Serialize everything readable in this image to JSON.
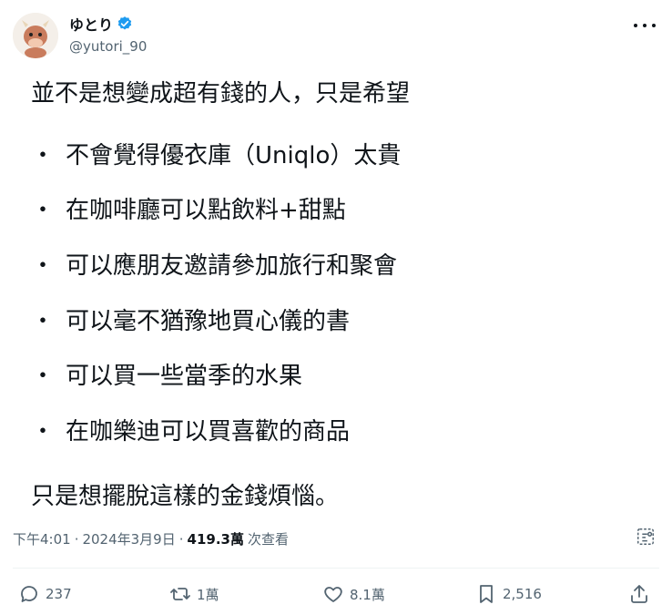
{
  "author": {
    "display_name": "ゆとり",
    "handle": "@yutori_90",
    "verified": true,
    "avatar_icon": "cartoon-cow-avatar"
  },
  "tweet": {
    "lines": [
      "並不是想變成超有錢的人，只是希望"
    ],
    "bullets": [
      "不會覺得優衣庫（Uniqlo）太貴",
      "在咖啡廳可以點飲料+甜點",
      "可以應朋友邀請參加旅行和聚會",
      "可以毫不猶豫地買心儀的書",
      "可以買一些當季的水果",
      "在咖樂迪可以買喜歡的商品"
    ],
    "bullet_symbol": "・",
    "closing": "只是想擺脫這樣的金錢煩惱。"
  },
  "meta": {
    "time": "下午4:01",
    "sep": "·",
    "date": "2024年3月9日",
    "sep2": "·",
    "views": "419.3萬",
    "views_label": "次查看"
  },
  "actions": {
    "reply_count": "237",
    "retweet_count": "1萬",
    "like_count": "8.1萬",
    "bookmark_count": "2,516"
  },
  "colors": {
    "text": "#0f1419",
    "muted": "#536471",
    "verified_blue": "#1d9bf0"
  }
}
